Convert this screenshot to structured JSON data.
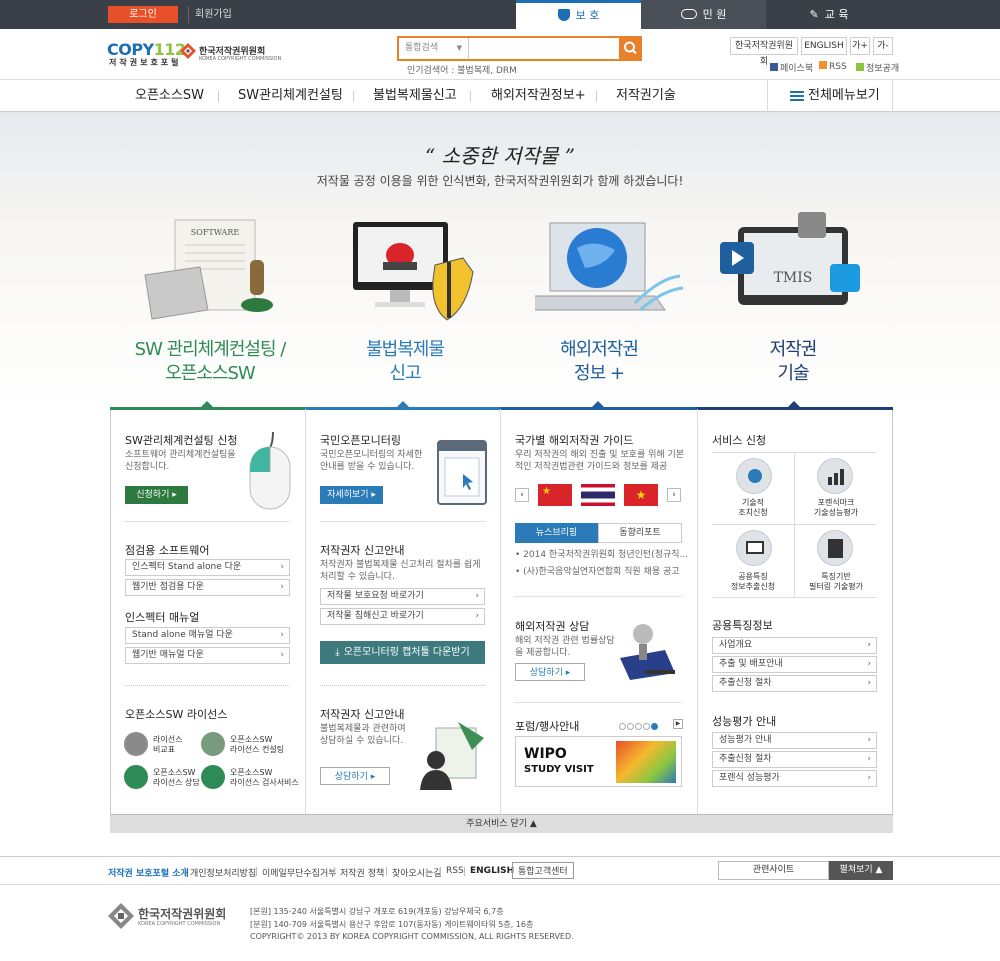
{
  "topbar": {
    "login": "로그인",
    "join": "회원가입",
    "tabs": [
      {
        "label": "보 호"
      },
      {
        "label": "민 원"
      },
      {
        "label": "교 육"
      }
    ]
  },
  "header": {
    "logo_a": "COPY",
    "logo_b": "112",
    "logo_sub": "저작권보호포털",
    "kcc_name": "한국저작권위원회",
    "kcc_en": "KOREA COPYRIGHT COMMISSION",
    "search_scope": "통합검색",
    "search_value": "",
    "popular": "인기검색어 : 불법복제, DRM",
    "buttons": {
      "kcc": "한국저작권위원회",
      "english": "ENGLISH",
      "font_up": "가+",
      "font_down": "가-"
    },
    "links": {
      "facebook": "페이스북",
      "rss": "RSS",
      "open": "정보공개"
    }
  },
  "gnb": {
    "items": [
      "오픈소스SW",
      "SW관리체계컨설팅",
      "불법복제물신고",
      "해외저작권정보+",
      "저작권기술"
    ],
    "all": "전체메뉴보기"
  },
  "hero": {
    "title": "“ 소중한 저작물 ”",
    "subtitle": "저작물 공정 이용을 위한 인식변화, 한국저작권위원회가 함께 하겠습니다!",
    "software_label": "SOFTWARE",
    "tmis_label": "TMIS"
  },
  "categories": [
    {
      "line1": "SW 관리체계컨설팅 /",
      "line2": "오픈소스SW",
      "color": "#2e8b57"
    },
    {
      "line1": "불법복제물",
      "line2": "신고",
      "color": "#2a7bb8"
    },
    {
      "line1": "해외저작권",
      "line2": "정보 +",
      "color": "#1f5f9e"
    },
    {
      "line1": "저작권",
      "line2": "기술",
      "color": "#1d3f73"
    }
  ],
  "col1": {
    "apply_title": "SW관리체계컨설팅 신청",
    "apply_desc1": "소프트웨어 관리체계컨설팅을",
    "apply_desc2": "신청합니다.",
    "apply_btn": "신청하기 ▸",
    "check_title": "점검용 소프트웨어",
    "check_links": [
      "인스펙터 Stand alone 다운",
      "웹기반 점검용 다운"
    ],
    "manual_title": "인스펙터 매뉴얼",
    "manual_links": [
      "Stand alone 매뉴얼 다운",
      "웹기반 매뉴얼 다운"
    ],
    "license_title": "오픈소스SW 라이선스",
    "license_items": [
      {
        "l1": "라이선스",
        "l2": "비교표"
      },
      {
        "l1": "오픈소스SW",
        "l2": "라이선스 컨설팅"
      },
      {
        "l1": "오픈소스SW",
        "l2": "라이선스 상담"
      },
      {
        "l1": "오픈소스SW",
        "l2": "라이선스 검사서비스"
      }
    ]
  },
  "col2": {
    "monitor_title": "국민오픈모니터링",
    "monitor_desc1": "국민오픈모니터링의 자세한",
    "monitor_desc2": "안내를 받을 수 있습니다.",
    "monitor_btn": "자세히보기 ▸",
    "report_title": "저작권자 신고안내",
    "report_desc1": "저작권자 불법복제물 신고처리 절차를 쉽게",
    "report_desc2": "처리할 수 있습니다.",
    "report_links": [
      "저작물 보호요청 바로가기",
      "저작물 침해신고 바로가기"
    ],
    "download_btn": "오픈모니터링 캡처툴 다운받기",
    "report2_title": "저작권자 신고안내",
    "report2_desc1": "불법복제물과 관련하여",
    "report2_desc2": "상담하실 수 있습니다.",
    "consult_btn": "상담하기 ▸"
  },
  "col3": {
    "guide_title": "국가별 해외저작권 가이드",
    "guide_desc1": "우리 저작권의 해외 진출 및 보호를 위해 기본",
    "guide_desc2": "적인 저작권법관련 가이드와 정보를 제공",
    "tabs": [
      "뉴스브리핑",
      "동향리포트"
    ],
    "news": [
      "2014 한국저작권위원회 청년인턴(정규직...",
      "(사)한국음악실연자연합회 직원 채용 공고"
    ],
    "consult_title": "해외저작권 상담",
    "consult_desc1": "해외 저작권 관련 법률상담",
    "consult_desc2": "을 제공합니다.",
    "consult_btn": "상담하기 ▸",
    "forum_title": "포럼/행사안내",
    "wipo_line1": "WIPO",
    "wipo_line2": "STUDY VISIT"
  },
  "col4": {
    "service_title": "서비스 신청",
    "services": [
      {
        "l1": "기술적",
        "l2": "조치신청"
      },
      {
        "l1": "포렌식마크",
        "l2": "기술성능평가"
      },
      {
        "l1": "공용특징",
        "l2": "정보추출신청"
      },
      {
        "l1": "특징기반",
        "l2": "필터링 기술평가"
      }
    ],
    "feature_title": "공용특징정보",
    "feature_links": [
      "사업개요",
      "추출 및 배포안내",
      "추출신청 절차"
    ],
    "eval_title": "성능평가 안내",
    "eval_links": [
      "성능평가 안내",
      "추출신청 절차",
      "포렌식 성능평가"
    ]
  },
  "panel": {
    "close": "주요서비스 닫기 ▲"
  },
  "footer": {
    "links": [
      "저작권 보호포털 소개",
      "개인정보처리방침",
      "이메일무단수집거부",
      "저작권 정책",
      "찾아오시는길",
      "RSS",
      "ENGLISH",
      "통합고객센터"
    ],
    "related": "관련사이트",
    "open_btn": "펼쳐보기 ▲",
    "org": "한국저작권위원회",
    "org_en": "KOREA COPYRIGHT COMMISSION",
    "addr1": "[본원] 135-240 서울특별시 강남구 개포로 619(개포동) 강남우체국 6,7층",
    "addr2": "[분원] 140-709 서울특별시 용산구 후암로 107(동자동) 게이트웨이타워 5층, 16층",
    "copyright": "COPYRIGHT© 2013 BY KOREA COPYRIGHT COMMISSION, ALL RIGHTS RESERVED."
  },
  "colors": {
    "orange": "#e8502a",
    "blue": "#1c6fb5",
    "green": "#2e8b57",
    "navy": "#1d3f73",
    "dark": "#3b3f47"
  }
}
